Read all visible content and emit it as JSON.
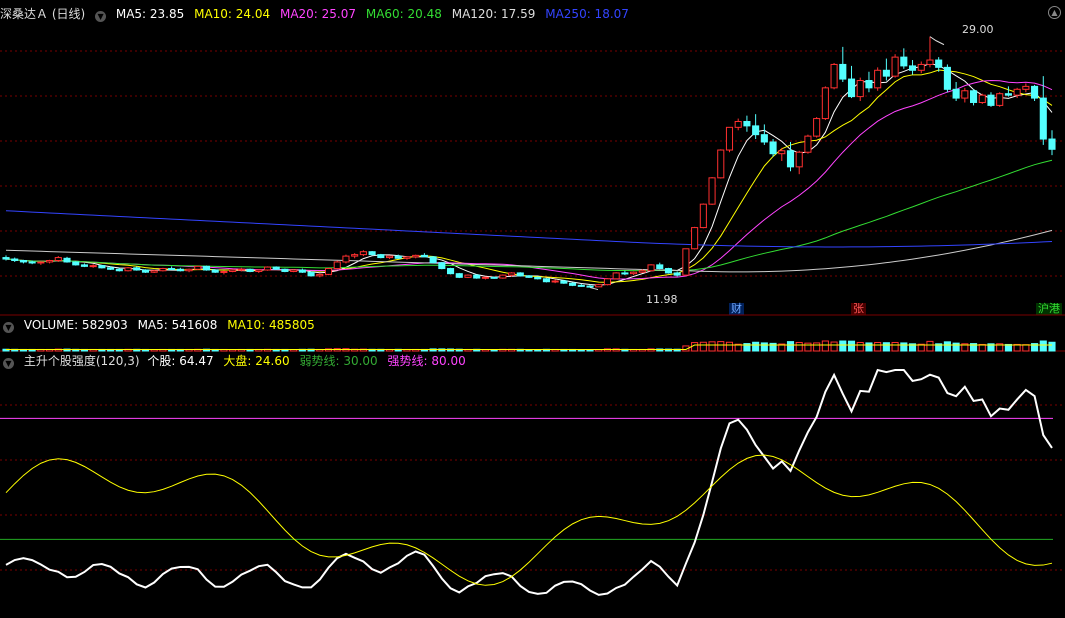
{
  "price_panel": {
    "title": "深桑达Ａ (日线)",
    "indicators": [
      {
        "label": "MA5: 23.85",
        "color": "#ffffff"
      },
      {
        "label": "MA10: 24.04",
        "color": "#ffff00"
      },
      {
        "label": "MA20: 25.07",
        "color": "#ff44ff"
      },
      {
        "label": "MA60: 20.48",
        "color": "#33dd33"
      },
      {
        "label": "MA120: 17.59",
        "color": "#dddddd"
      },
      {
        "label": "MA250: 18.07",
        "color": "#3344ff"
      }
    ],
    "high_label": "29.00",
    "low_label": "11.98",
    "tags": [
      {
        "label": "财",
        "color": "#6fa8ff"
      },
      {
        "label": "张",
        "color": "#ff5555"
      },
      {
        "label": "沪港",
        "color": "#33dd33"
      }
    ]
  },
  "volume_panel": {
    "indicators": [
      {
        "label": "VOLUME: 582903",
        "color": "#ffffff"
      },
      {
        "label": "MA5: 541608",
        "color": "#ffffff"
      },
      {
        "label": "MA10: 485805",
        "color": "#ffff00"
      }
    ]
  },
  "strength_panel": {
    "indicators": [
      {
        "label": "主升个股强度(120,3)",
        "color": "#dddddd"
      },
      {
        "label": "个股: 64.47",
        "color": "#ffffff"
      },
      {
        "label": "大盘: 24.60",
        "color": "#ffff00"
      },
      {
        "label": "弱势线: 30.00",
        "color": "#33aa33"
      },
      {
        "label": "强势线: 80.00",
        "color": "#ff44ff"
      }
    ]
  },
  "colors": {
    "up": "#ff3030",
    "down": "#54ffff",
    "grid": "#7a0000"
  },
  "chart_data": {
    "type": "candlestick",
    "candles": [
      [
        13.9,
        14.05,
        13.7,
        13.8
      ],
      [
        13.8,
        13.9,
        13.6,
        13.7
      ],
      [
        13.7,
        13.75,
        13.5,
        13.6
      ],
      [
        13.6,
        13.7,
        13.45,
        13.55
      ],
      [
        13.55,
        13.65,
        13.4,
        13.6
      ],
      [
        13.6,
        13.75,
        13.5,
        13.7
      ],
      [
        13.7,
        14.0,
        13.6,
        13.9
      ],
      [
        13.85,
        13.95,
        13.55,
        13.6
      ],
      [
        13.6,
        13.65,
        13.35,
        13.4
      ],
      [
        13.4,
        13.5,
        13.25,
        13.3
      ],
      [
        13.3,
        13.45,
        13.2,
        13.35
      ],
      [
        13.35,
        13.4,
        13.15,
        13.2
      ],
      [
        13.2,
        13.3,
        13.05,
        13.1
      ],
      [
        13.1,
        13.2,
        12.95,
        13.0
      ],
      [
        13.0,
        13.25,
        12.95,
        13.2
      ],
      [
        13.2,
        13.3,
        13.0,
        13.05
      ],
      [
        13.05,
        13.1,
        12.85,
        12.9
      ],
      [
        12.9,
        13.05,
        12.85,
        13.0
      ],
      [
        13.0,
        13.2,
        12.95,
        13.15
      ],
      [
        13.15,
        13.3,
        13.05,
        13.1
      ],
      [
        13.1,
        13.2,
        12.95,
        13.0
      ],
      [
        13.0,
        13.15,
        12.9,
        13.1
      ],
      [
        13.1,
        13.35,
        13.05,
        13.3
      ],
      [
        13.3,
        13.35,
        13.0,
        13.05
      ],
      [
        13.05,
        13.1,
        12.85,
        12.9
      ],
      [
        12.9,
        13.0,
        12.75,
        12.95
      ],
      [
        12.95,
        13.1,
        12.9,
        13.05
      ],
      [
        13.05,
        13.2,
        12.95,
        13.1
      ],
      [
        13.1,
        13.15,
        12.9,
        12.95
      ],
      [
        12.95,
        13.1,
        12.85,
        13.05
      ],
      [
        13.05,
        13.3,
        13.0,
        13.25
      ],
      [
        13.25,
        13.3,
        13.05,
        13.1
      ],
      [
        13.1,
        13.15,
        12.9,
        12.95
      ],
      [
        12.95,
        13.1,
        12.9,
        13.05
      ],
      [
        13.05,
        13.15,
        12.85,
        12.9
      ],
      [
        12.9,
        12.95,
        12.6,
        12.65
      ],
      [
        12.65,
        12.8,
        12.55,
        12.75
      ],
      [
        12.75,
        13.2,
        12.7,
        13.15
      ],
      [
        13.15,
        13.7,
        13.1,
        13.6
      ],
      [
        13.6,
        14.1,
        13.5,
        14.0
      ],
      [
        14.0,
        14.2,
        13.85,
        14.1
      ],
      [
        14.1,
        14.4,
        14.0,
        14.3
      ],
      [
        14.3,
        14.35,
        14.05,
        14.1
      ],
      [
        14.1,
        14.15,
        13.85,
        13.9
      ],
      [
        13.9,
        14.05,
        13.8,
        14.0
      ],
      [
        14.0,
        14.1,
        13.8,
        13.85
      ],
      [
        13.85,
        14.0,
        13.75,
        13.95
      ],
      [
        13.95,
        14.1,
        13.85,
        14.05
      ],
      [
        14.05,
        14.2,
        13.95,
        13.95
      ],
      [
        13.95,
        14.0,
        13.5,
        13.55
      ],
      [
        13.55,
        13.6,
        13.1,
        13.15
      ],
      [
        13.15,
        13.2,
        12.75,
        12.8
      ],
      [
        12.8,
        12.85,
        12.5,
        12.55
      ],
      [
        12.55,
        12.75,
        12.5,
        12.7
      ],
      [
        12.7,
        12.75,
        12.45,
        12.5
      ],
      [
        12.5,
        12.6,
        12.4,
        12.55
      ],
      [
        12.55,
        12.6,
        12.45,
        12.5
      ],
      [
        12.5,
        12.75,
        12.45,
        12.7
      ],
      [
        12.7,
        12.9,
        12.6,
        12.85
      ],
      [
        12.85,
        12.9,
        12.6,
        12.65
      ],
      [
        12.65,
        12.7,
        12.5,
        12.55
      ],
      [
        12.55,
        12.6,
        12.4,
        12.45
      ],
      [
        12.45,
        12.5,
        12.2,
        12.25
      ],
      [
        12.25,
        12.4,
        12.15,
        12.3
      ],
      [
        12.3,
        12.35,
        12.1,
        12.15
      ],
      [
        12.15,
        12.2,
        11.95,
        12.0
      ],
      [
        12.0,
        12.1,
        11.9,
        11.95
      ],
      [
        11.95,
        12.05,
        11.85,
        11.9
      ],
      [
        11.9,
        12.1,
        11.88,
        12.05
      ],
      [
        12.05,
        12.5,
        12.0,
        12.45
      ],
      [
        12.45,
        12.9,
        12.4,
        12.85
      ],
      [
        12.85,
        13.0,
        12.7,
        12.8
      ],
      [
        12.8,
        12.95,
        12.7,
        12.9
      ],
      [
        12.9,
        13.1,
        12.85,
        13.0
      ],
      [
        13.0,
        13.45,
        12.95,
        13.4
      ],
      [
        13.4,
        13.55,
        13.1,
        13.15
      ],
      [
        13.15,
        13.2,
        12.8,
        12.85
      ],
      [
        12.85,
        12.95,
        12.6,
        12.7
      ],
      [
        12.7,
        14.5,
        12.65,
        14.5
      ],
      [
        14.5,
        16.0,
        14.45,
        15.95
      ],
      [
        15.95,
        17.6,
        15.9,
        17.55
      ],
      [
        17.55,
        19.4,
        17.5,
        19.35
      ],
      [
        19.35,
        21.3,
        19.3,
        21.25
      ],
      [
        21.25,
        22.8,
        21.1,
        22.8
      ],
      [
        22.8,
        23.4,
        22.6,
        23.2
      ],
      [
        23.2,
        23.6,
        22.5,
        22.9
      ],
      [
        22.9,
        23.7,
        22.0,
        22.3
      ],
      [
        22.3,
        23.0,
        21.6,
        21.8
      ],
      [
        21.8,
        22.0,
        20.8,
        21.0
      ],
      [
        21.0,
        21.4,
        20.5,
        21.2
      ],
      [
        21.2,
        21.8,
        19.8,
        20.1
      ],
      [
        20.1,
        21.2,
        19.6,
        21.1
      ],
      [
        21.1,
        22.3,
        21.0,
        22.2
      ],
      [
        22.2,
        23.5,
        22.1,
        23.4
      ],
      [
        23.4,
        25.6,
        23.3,
        25.5
      ],
      [
        25.5,
        27.2,
        25.4,
        27.1
      ],
      [
        27.1,
        28.3,
        25.9,
        26.1
      ],
      [
        26.1,
        27.0,
        24.8,
        24.9
      ],
      [
        24.9,
        26.2,
        24.6,
        26.0
      ],
      [
        26.0,
        26.6,
        25.2,
        25.5
      ],
      [
        25.5,
        26.9,
        25.3,
        26.7
      ],
      [
        26.7,
        27.5,
        26.0,
        26.3
      ],
      [
        26.3,
        27.8,
        26.2,
        27.6
      ],
      [
        27.6,
        28.2,
        26.8,
        27.0
      ],
      [
        27.0,
        27.4,
        26.4,
        26.7
      ],
      [
        26.7,
        27.3,
        26.5,
        27.1
      ],
      [
        27.1,
        29.0,
        26.9,
        27.4
      ],
      [
        27.4,
        27.6,
        26.6,
        26.9
      ],
      [
        26.9,
        27.1,
        25.2,
        25.4
      ],
      [
        25.4,
        25.9,
        24.6,
        24.8
      ],
      [
        24.8,
        25.5,
        24.5,
        25.3
      ],
      [
        25.3,
        25.4,
        24.3,
        24.5
      ],
      [
        24.5,
        25.1,
        24.4,
        25.0
      ],
      [
        25.0,
        25.2,
        24.2,
        24.3
      ],
      [
        24.3,
        25.2,
        24.2,
        25.1
      ],
      [
        25.1,
        25.6,
        24.9,
        25.0
      ],
      [
        25.0,
        25.5,
        24.8,
        25.4
      ],
      [
        25.4,
        25.8,
        25.2,
        25.6
      ],
      [
        25.6,
        25.7,
        24.6,
        24.8
      ],
      [
        24.8,
        26.3,
        21.6,
        22.0
      ],
      [
        22.0,
        22.6,
        20.9,
        21.3
      ]
    ]
  }
}
